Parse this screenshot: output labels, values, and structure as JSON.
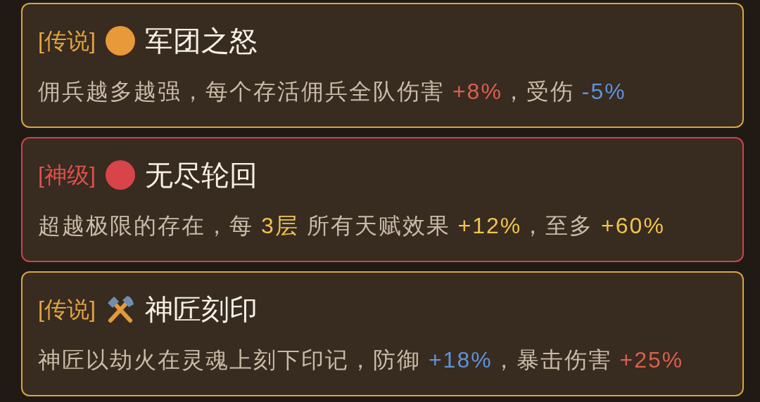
{
  "cards": [
    {
      "tier": "[传说]",
      "kind": "legendary",
      "icon": {
        "kind": "dot",
        "color": "#e8993a"
      },
      "title": "军团之怒",
      "description": [
        {
          "text": "佣兵越多越强，每个存活佣兵全队伤害 ",
          "kind": "plain"
        },
        {
          "text": "+8%",
          "kind": "red"
        },
        {
          "text": "，受伤 ",
          "kind": "plain"
        },
        {
          "text": "-5%",
          "kind": "blue"
        }
      ]
    },
    {
      "tier": "[神级]",
      "kind": "divine",
      "icon": {
        "kind": "dot",
        "color": "#d9434a"
      },
      "title": "无尽轮回",
      "description": [
        {
          "text": "超越极限的存在，每 ",
          "kind": "plain"
        },
        {
          "text": "3层",
          "kind": "gold"
        },
        {
          "text": " 所有天赋效果 ",
          "kind": "plain"
        },
        {
          "text": "+12%",
          "kind": "gold"
        },
        {
          "text": "，至多 ",
          "kind": "plain"
        },
        {
          "text": "+60%",
          "kind": "gold"
        }
      ]
    },
    {
      "tier": "[传说]",
      "kind": "legendary",
      "icon": {
        "kind": "hammers"
      },
      "title": "神匠刻印",
      "description": [
        {
          "text": "神匠以劫火在灵魂上刻下印记，防御 ",
          "kind": "plain"
        },
        {
          "text": "+18%",
          "kind": "blue"
        },
        {
          "text": "，暴击伤害 ",
          "kind": "plain"
        },
        {
          "text": "+25%",
          "kind": "red"
        }
      ]
    }
  ]
}
